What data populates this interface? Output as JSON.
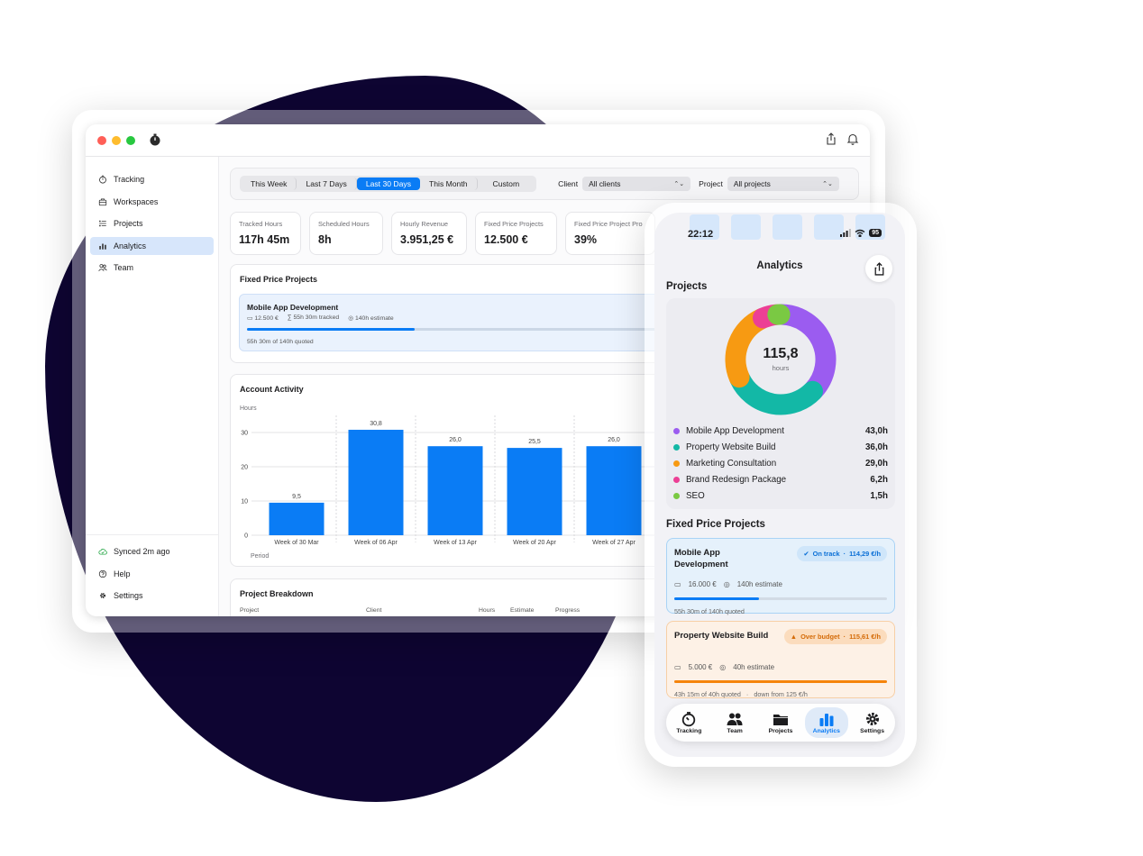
{
  "desktop": {
    "sidebar": {
      "items": [
        {
          "label": "Tracking",
          "icon": "stopwatch-icon",
          "active": false
        },
        {
          "label": "Workspaces",
          "icon": "briefcase-icon",
          "active": false
        },
        {
          "label": "Projects",
          "icon": "list-icon",
          "active": false
        },
        {
          "label": "Analytics",
          "icon": "chart-icon",
          "active": true
        },
        {
          "label": "Team",
          "icon": "people-icon",
          "active": false
        }
      ],
      "footer": [
        {
          "label": "Synced 2m ago",
          "icon": "cloud-check-icon"
        },
        {
          "label": "Help",
          "icon": "help-icon"
        },
        {
          "label": "Settings",
          "icon": "gear-icon"
        }
      ]
    },
    "filters": {
      "ranges": [
        "This Week",
        "Last 7 Days",
        "Last 30 Days",
        "This Month",
        "Custom"
      ],
      "selected_range": "Last 30 Days",
      "client_label": "Client",
      "client_value": "All clients",
      "project_label": "Project",
      "project_value": "All projects"
    },
    "stats": [
      {
        "label": "Tracked Hours",
        "value": "117h 45m"
      },
      {
        "label": "Scheduled Hours",
        "value": "8h"
      },
      {
        "label": "Hourly Revenue",
        "value": "3.951,25 €"
      },
      {
        "label": "Fixed Price Projects",
        "value": "12.500 €"
      },
      {
        "label": "Fixed Price Project Pro",
        "value": "39%"
      }
    ],
    "fixed_price": {
      "title": "Fixed Price Projects",
      "project": {
        "name": "Mobile App Development",
        "price": "12.500 €",
        "tracked": "55h 30m tracked",
        "estimate": "140h estimate",
        "progress": 0.396,
        "quoted": "55h 30m of 140h quoted"
      }
    },
    "activity": {
      "title": "Account Activity"
    },
    "breakdown": {
      "title": "Project Breakdown",
      "columns": [
        "Project",
        "Client",
        "Hours",
        "Estimate",
        "Progress"
      ]
    }
  },
  "chart_data": {
    "type": "bar",
    "title": "Account Activity",
    "ylabel": "Hours",
    "xlabel": "Period",
    "categories": [
      "Week of 30 Mar",
      "Week of 06 Apr",
      "Week of 13 Apr",
      "Week of 20 Apr",
      "Week of 27 Apr"
    ],
    "values": [
      9.5,
      30.8,
      26.0,
      25.5,
      26.0
    ],
    "value_labels": [
      "9,5",
      "30,8",
      "26,0",
      "25,5",
      "26,0"
    ],
    "yticks": [
      "0",
      "10",
      "20",
      "30"
    ],
    "ylim": [
      0,
      35
    ],
    "color": "#0a7cf5",
    "grid": true
  },
  "phone": {
    "time": "22:12",
    "battery": "95",
    "title": "Analytics",
    "projects_heading": "Projects",
    "donut": {
      "total": "115,8",
      "unit": "hours",
      "segments": [
        {
          "name": "Mobile App Development",
          "hours": "43,0h",
          "value": 43.0,
          "color": "#9b5cf0"
        },
        {
          "name": "Property Website Build",
          "hours": "36,0h",
          "value": 36.0,
          "color": "#13b8a6"
        },
        {
          "name": "Marketing Consultation",
          "hours": "29,0h",
          "value": 29.0,
          "color": "#f79a12"
        },
        {
          "name": "Brand Redesign Package",
          "hours": "6,2h",
          "value": 6.2,
          "color": "#ec3f95"
        },
        {
          "name": "SEO",
          "hours": "1,5h",
          "value": 1.5,
          "color": "#7ac943"
        }
      ]
    },
    "fixed_heading": "Fixed Price Projects",
    "cards": [
      {
        "name": "Mobile App Development",
        "status": "On track",
        "rate": "114,29 €/h",
        "price": "16.000 €",
        "estimate": "140h estimate",
        "progress": 0.4,
        "foot": "55h 30m of 140h quoted",
        "note": "",
        "bg": "#e5f1fb",
        "border": "#a9d3f5",
        "pill_bg": "#cfe6fa",
        "pill_fg": "#0a6fd6",
        "bar": "#0a7cf5",
        "track": "#d2dbe5"
      },
      {
        "name": "Property Website Build",
        "status": "Over budget",
        "rate": "115,61 €/h",
        "price": "5.000 €",
        "estimate": "40h estimate",
        "progress": 1.0,
        "foot": "43h 15m of 40h quoted",
        "note": "down from 125 €/h",
        "bg": "#fdf1e6",
        "border": "#f7cfa6",
        "pill_bg": "#fbdcbd",
        "pill_fg": "#d46b08",
        "bar": "#f5840b",
        "track": "#eed8c2"
      }
    ],
    "tabs": [
      {
        "label": "Tracking",
        "icon": "stopwatch-icon",
        "active": false
      },
      {
        "label": "Team",
        "icon": "people-icon",
        "active": false
      },
      {
        "label": "Projects",
        "icon": "folder-icon",
        "active": false
      },
      {
        "label": "Analytics",
        "icon": "chart-icon",
        "active": true
      },
      {
        "label": "Settings",
        "icon": "gear-icon",
        "active": false
      }
    ]
  }
}
